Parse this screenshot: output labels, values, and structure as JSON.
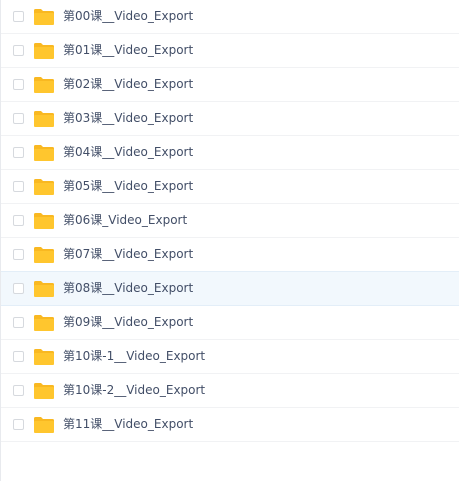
{
  "colors": {
    "text": "#424e67",
    "folder": "#ffc62e",
    "folder_back": "#f9b821",
    "row_hover_bg": "#f2f8fd",
    "checkbox_border": "#d6d9de"
  },
  "file_list": {
    "items": [
      {
        "name": "第00课__Video_Export",
        "icon": "folder-icon",
        "hovered": false
      },
      {
        "name": "第01课__Video_Export",
        "icon": "folder-icon",
        "hovered": false
      },
      {
        "name": "第02课__Video_Export",
        "icon": "folder-icon",
        "hovered": false
      },
      {
        "name": "第03课__Video_Export",
        "icon": "folder-icon",
        "hovered": false
      },
      {
        "name": "第04课__Video_Export",
        "icon": "folder-icon",
        "hovered": false
      },
      {
        "name": "第05课__Video_Export",
        "icon": "folder-icon",
        "hovered": false
      },
      {
        "name": "第06课_Video_Export",
        "icon": "folder-icon",
        "hovered": false
      },
      {
        "name": "第07课__Video_Export",
        "icon": "folder-icon",
        "hovered": false
      },
      {
        "name": "第08课__Video_Export",
        "icon": "folder-icon",
        "hovered": true
      },
      {
        "name": "第09课__Video_Export",
        "icon": "folder-icon",
        "hovered": false
      },
      {
        "name": "第10课-1__Video_Export",
        "icon": "folder-icon",
        "hovered": false
      },
      {
        "name": "第10课-2__Video_Export",
        "icon": "folder-icon",
        "hovered": false
      },
      {
        "name": "第11课__Video_Export",
        "icon": "folder-icon",
        "hovered": false
      }
    ]
  }
}
